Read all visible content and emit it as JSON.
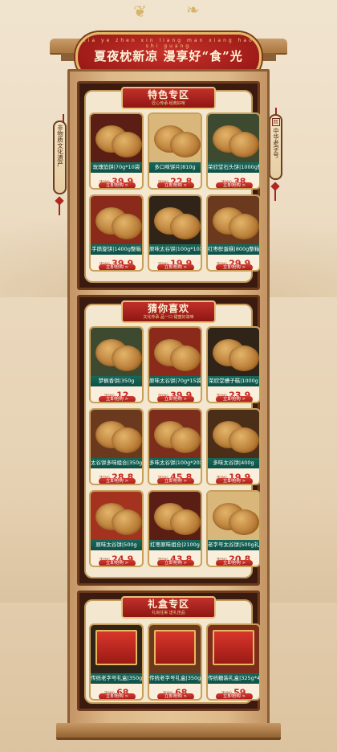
{
  "header": {
    "pinyin": "xia ye zhen xin liang man xiang hao shi guang",
    "headline": "夏夜枕新凉 漫享好“食”光"
  },
  "side_tags": {
    "left": "非物质文化遗产",
    "right": "中华老字号",
    "right_stamp": "回"
  },
  "sections": [
    {
      "id": "featured",
      "title": "特色专区",
      "subtitle": "匠心传承·经典好味",
      "products": [
        {
          "name": "玫瑰馅饼|70g*10袋",
          "price_label": "活动价",
          "price": "39.9",
          "buy": "立即抢购 >"
        },
        {
          "name": "多口味饼片|810g",
          "price_label": "活动价",
          "price": "22.8",
          "buy": "立即抢购 >"
        },
        {
          "name": "荣欣堂石头饼|1000g整箱",
          "price_label": "活动价",
          "price": "38",
          "buy": "立即抢购 >"
        },
        {
          "name": "手撕旋饼|1400g整箱",
          "price_label": "活动价",
          "price": "39.9",
          "buy": "立即抢购 >"
        },
        {
          "name": "原味太谷饼|100g*10袋",
          "price_label": "活动价",
          "price": "19.9",
          "buy": "立即抢购 >"
        },
        {
          "name": "红枣鲜蛋糕|800g整箱",
          "price_label": "活动价",
          "price": "29.9",
          "buy": "立即抢购 >"
        }
      ]
    },
    {
      "id": "guess",
      "title": "猜你喜欢",
      "subtitle": "文化传承 品一口 甜蜜好滋味",
      "products": [
        {
          "name": "梦枫香饼|350g",
          "price_label": "活动价",
          "price": "12",
          "buy": "立即抢购 >"
        },
        {
          "name": "原味太谷饼|70g*15袋",
          "price_label": "活动价",
          "price": "39.9",
          "buy": "立即抢购 >"
        },
        {
          "name": "荣欣堂槽子糕|1000g",
          "price_label": "活动价",
          "price": "23.9",
          "buy": "立即抢购 >"
        },
        {
          "name": "太谷饼多味组合|350g*2袋",
          "price_label": "活动价",
          "price": "28.8",
          "buy": "立即抢购 >"
        },
        {
          "name": "多味太谷饼|100g*20袋",
          "price_label": "活动价",
          "price": "45.8",
          "buy": "立即抢购 >"
        },
        {
          "name": "多味太谷饼|400g",
          "price_label": "活动价",
          "price": "19.9",
          "buy": "立即抢购 >"
        },
        {
          "name": "原味太谷饼|500g",
          "price_label": "活动价",
          "price": "24.9",
          "buy": "立即抢购 >"
        },
        {
          "name": "红枣原味组合|2100g",
          "price_label": "活动价",
          "price": "43.8",
          "buy": "立即抢购 >"
        },
        {
          "name": "老字号太谷饼|500g礼盒",
          "price_label": "活动价",
          "price": "20.8",
          "buy": "立即抢购 >"
        }
      ]
    },
    {
      "id": "gift",
      "title": "礼盒专区",
      "subtitle": "礼尚往来 送礼佳品",
      "products": [
        {
          "name": "传统老字号礼盒|350g*6袋",
          "price_label": "活动价",
          "price": "68",
          "buy": "立即抢购 >"
        },
        {
          "name": "传统老字号礼盒|350g*6袋",
          "price_label": "活动价",
          "price": "68",
          "buy": "立即抢购 >"
        },
        {
          "name": "传统糖装礼盒|325g*4袋",
          "price_label": "活动价",
          "price": "59",
          "buy": "立即抢购 >"
        }
      ]
    }
  ],
  "theme": {
    "accent_red": "#c42a22",
    "name_bar_green": "#17685a",
    "frame_wood": "#8b5e33",
    "panel_cream": "#f4e7cf"
  }
}
